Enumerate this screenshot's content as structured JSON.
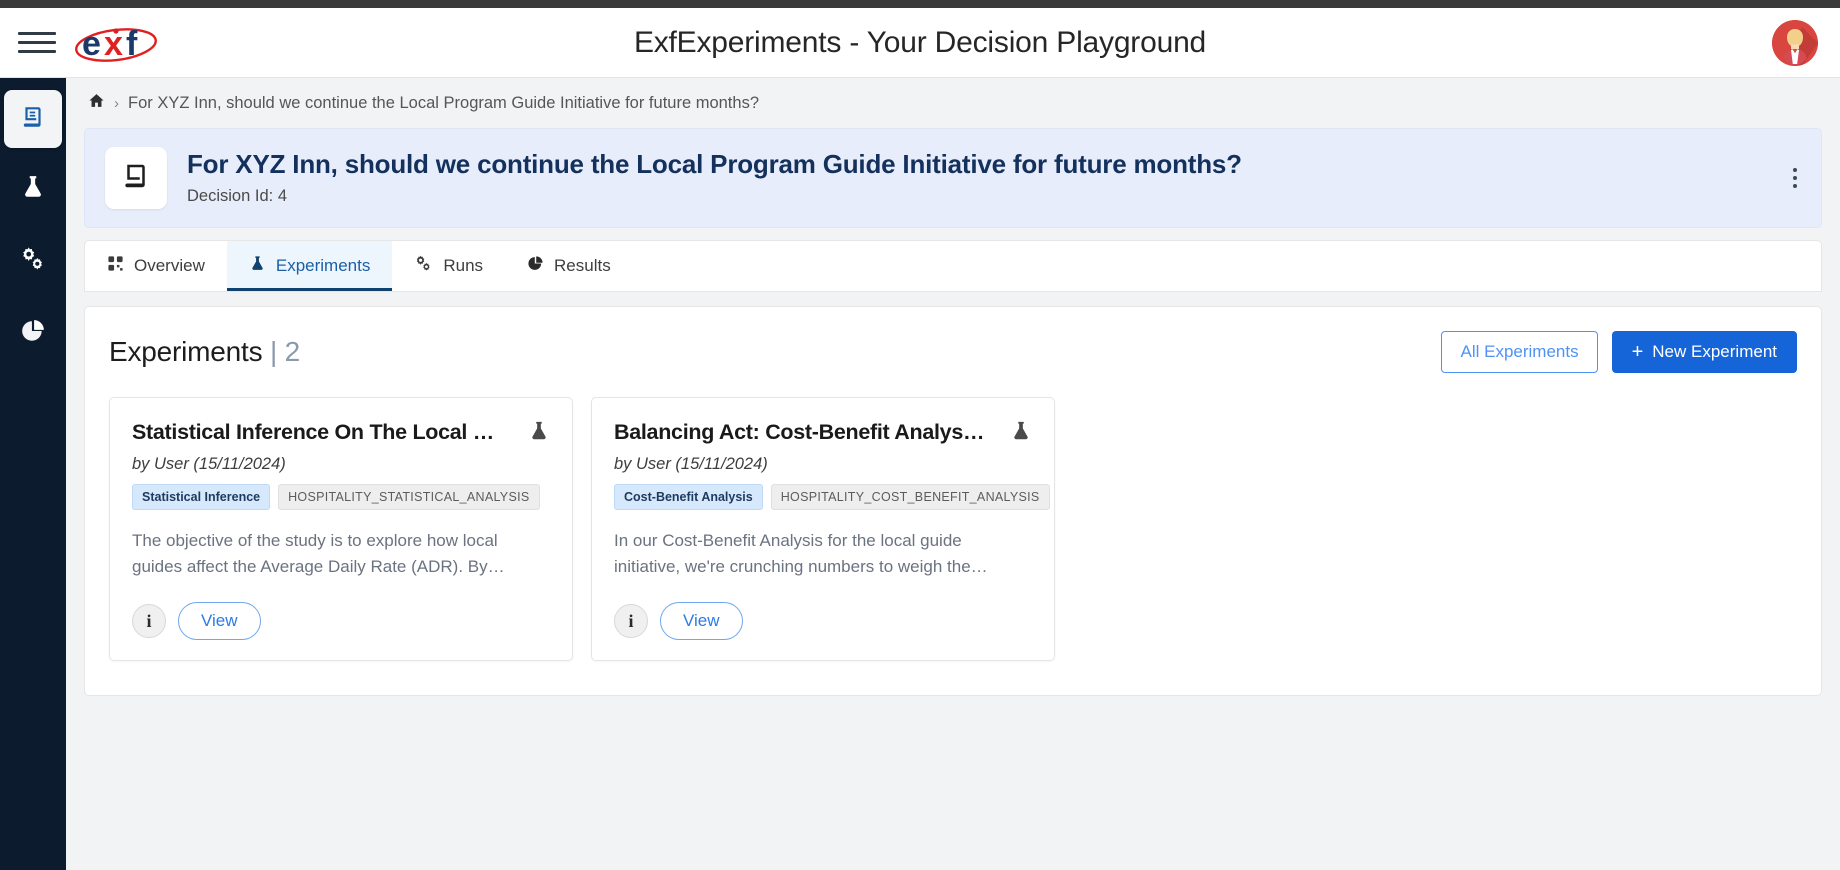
{
  "header": {
    "title": "ExfExperiments - Your Decision Playground",
    "logo_text": "exf",
    "menu_icon": "hamburger-menu-icon",
    "avatar_icon": "user-avatar"
  },
  "sidebar": {
    "items": [
      {
        "icon": "book-icon",
        "name": "decisions",
        "active": true
      },
      {
        "icon": "flask-icon",
        "name": "experiments",
        "active": false
      },
      {
        "icon": "gears-icon",
        "name": "runs",
        "active": false
      },
      {
        "icon": "pie-chart-icon",
        "name": "results",
        "active": false
      }
    ]
  },
  "breadcrumb": {
    "home_icon": "home-icon",
    "separator": "›",
    "current": "For XYZ Inn, should we continue the Local Program Guide Initiative for future months?"
  },
  "banner": {
    "icon": "book-icon",
    "title": "For XYZ Inn, should we continue the Local Program Guide Initiative for future months?",
    "decision_id_label": "Decision Id:",
    "decision_id_value": "4",
    "menu_icon": "vertical-dots-icon"
  },
  "tabs": [
    {
      "label": "Overview",
      "icon": "grid-icon",
      "active": false
    },
    {
      "label": "Experiments",
      "icon": "flask-icon",
      "active": true
    },
    {
      "label": "Runs",
      "icon": "gears-icon",
      "active": false
    },
    {
      "label": "Results",
      "icon": "pie-chart-icon",
      "active": false
    }
  ],
  "experiments_section": {
    "title": "Experiments",
    "count": "| 2",
    "all_experiments_label": "All Experiments",
    "new_experiment_label": "New Experiment",
    "new_experiment_plus": "+"
  },
  "cards": [
    {
      "title": "Statistical Inference On The Local G…",
      "byline": "by User (15/11/2024)",
      "tag_primary": "Statistical Inference",
      "tag_secondary": "HOSPITALITY_STATISTICAL_ANALYSIS",
      "description": "The objective of the study is to explore how local guides affect the Average Daily Rate (ADR). By closely…",
      "info_label": "i",
      "view_label": "View",
      "type_icon": "flask-icon"
    },
    {
      "title": "Balancing Act: Cost-Benefit Analysi…",
      "byline": "by User (15/11/2024)",
      "tag_primary": "Cost-Benefit Analysis",
      "tag_secondary": "HOSPITALITY_COST_BENEFIT_ANALYSIS",
      "description": "In our Cost-Benefit Analysis for the local guide initiative, we're crunching numbers to weigh the…",
      "info_label": "i",
      "view_label": "View",
      "type_icon": "flask-icon"
    }
  ],
  "colors": {
    "brand_navy": "#13315c",
    "brand_red": "#e02020",
    "primary_blue": "#1565d8",
    "link_blue": "#2c7be5",
    "sidebar_bg": "#0d1b2e",
    "banner_bg": "#e8edfb",
    "tab_active_bg": "#eef6fd"
  }
}
